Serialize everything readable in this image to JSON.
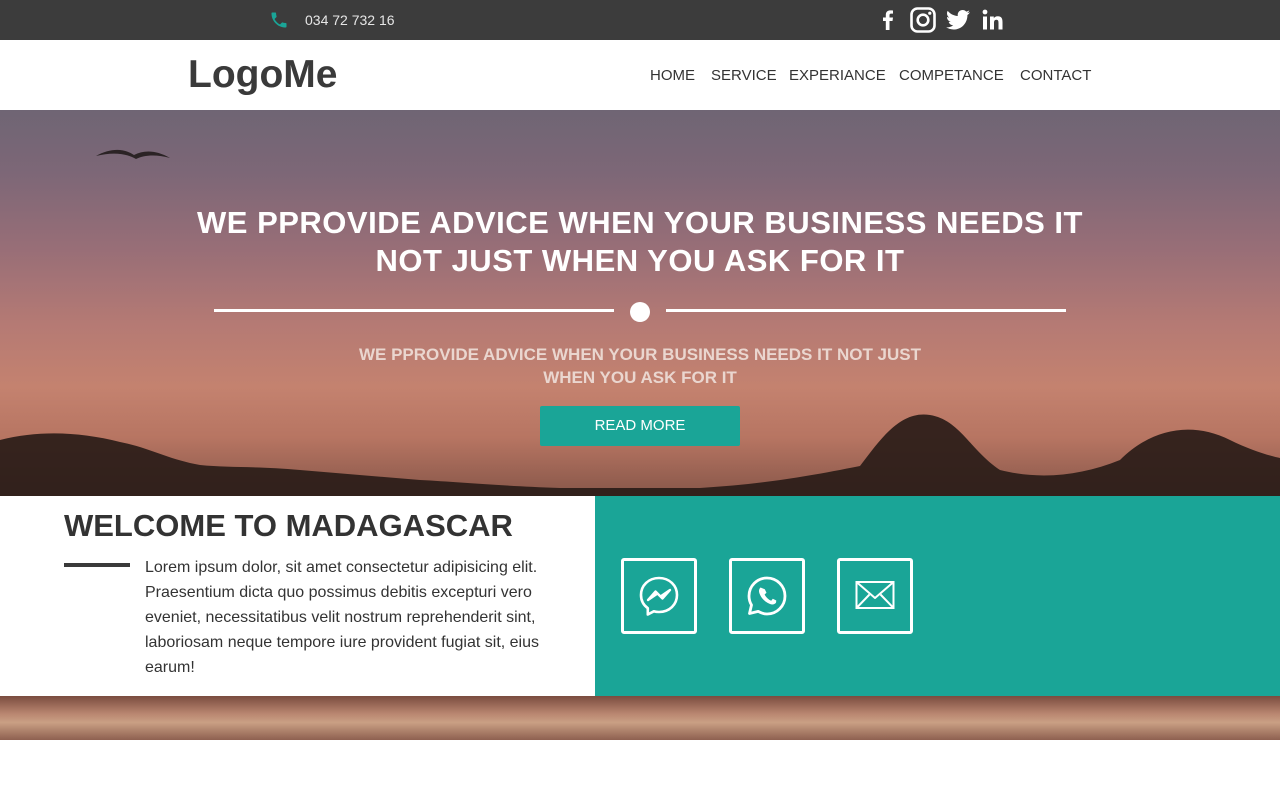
{
  "topbar": {
    "phone_icon": "phone-icon",
    "phone": "034 72 732 16",
    "social_icons": [
      "facebook-icon",
      "instagram-icon",
      "twitter-icon",
      "linkedin-icon"
    ]
  },
  "header": {
    "logo": "LogoMe",
    "nav": [
      "HOME",
      "SERVICE",
      "EXPERIANCE",
      "COMPETANCE",
      "CONTACT"
    ]
  },
  "hero": {
    "title_line1": "WE PPROVIDE ADVICE WHEN YOUR BUSINESS NEEDS IT",
    "title_line2": "NOT JUST WHEN YOU ASK FOR IT",
    "subtitle": "WE PPROVIDE ADVICE WHEN YOUR BUSINESS NEEDS IT NOT JUST WHEN YOU ASK FOR IT",
    "cta": "READ MORE"
  },
  "welcome": {
    "title": "WELCOME TO MADAGASCAR",
    "text": "Lorem ipsum dolor, sit amet consectetur adipisicing elit. Praesentium dicta quo possimus debitis excepturi vero eveniet, necessitatibus velit nostrum reprehenderit sint, laboriosam neque tempore iure provident fugiat sit, eius earum!"
  },
  "contact": {
    "icons": [
      "messenger-icon",
      "whatsapp-icon",
      "mail-icon"
    ]
  },
  "colors": {
    "accent": "#1aa597",
    "topbar": "#3c3c3c",
    "text_dark": "#333333"
  }
}
